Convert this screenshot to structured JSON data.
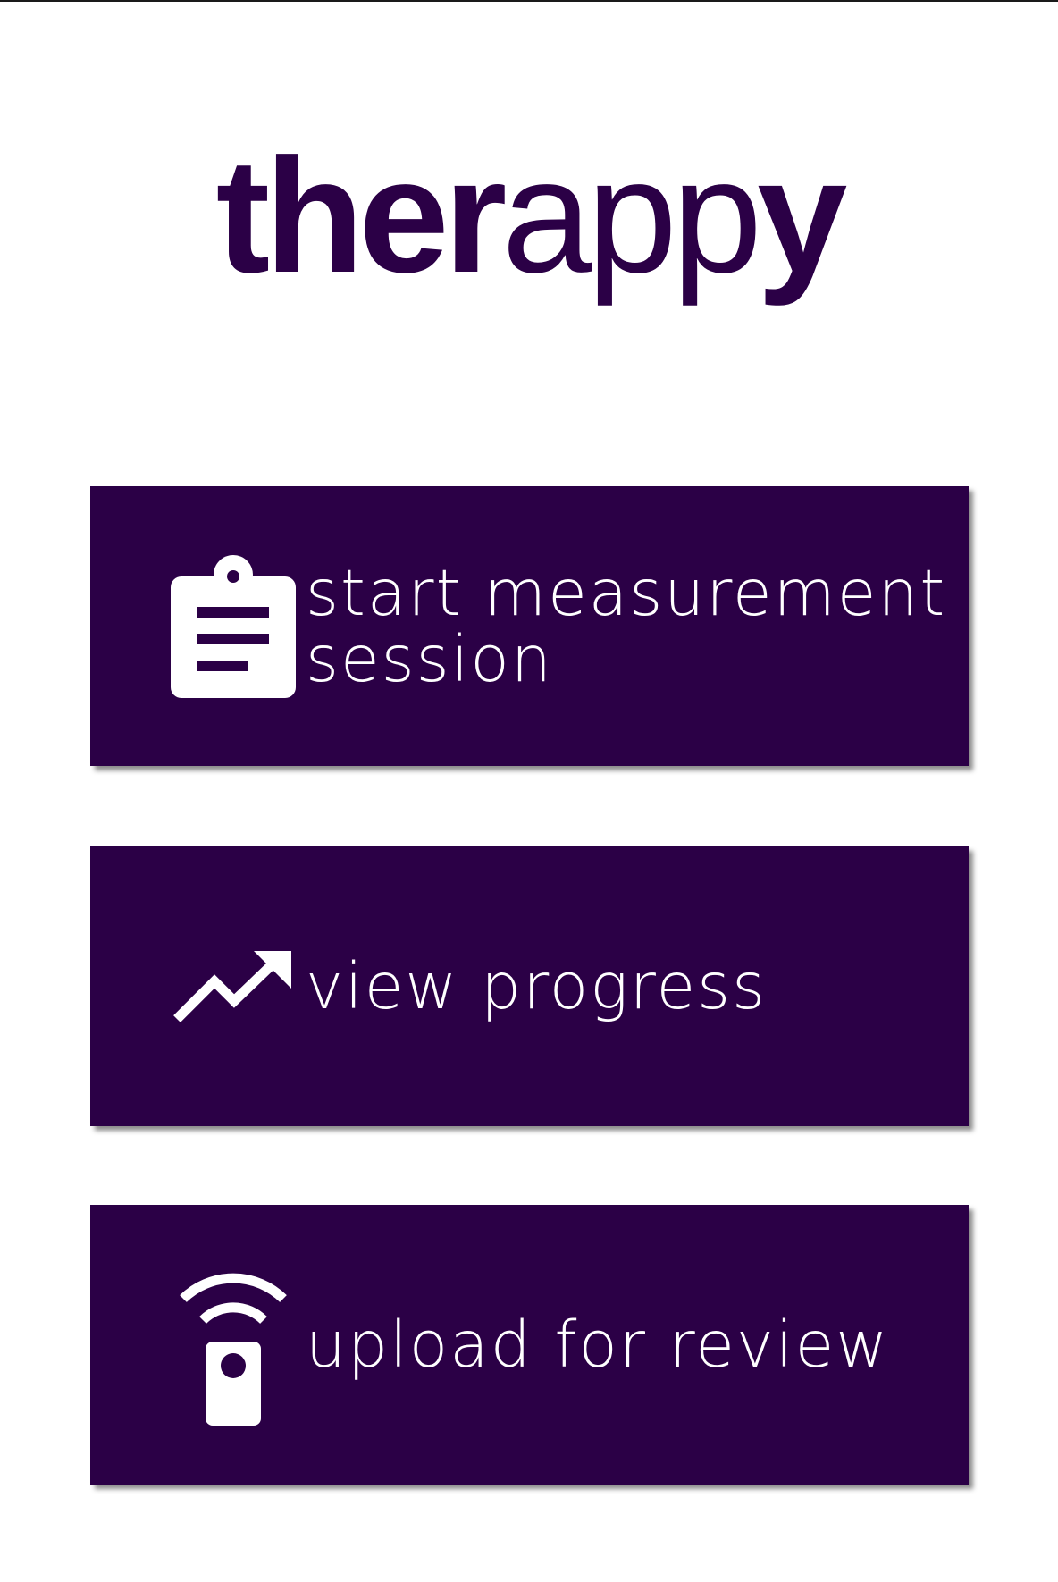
{
  "app": {
    "logo_bold_prefix": "ther",
    "logo_light_mid": "app",
    "logo_bold_suffix": "y"
  },
  "menu": {
    "items": [
      {
        "label": "start measurement session",
        "icon": "clipboard-icon"
      },
      {
        "label": "view progress",
        "icon": "trending-up-icon"
      },
      {
        "label": "upload for review",
        "icon": "remote-signal-icon"
      }
    ]
  },
  "colors": {
    "brand": "#2b0046",
    "text_on_brand": "#ffffff",
    "background": "#ffffff"
  }
}
